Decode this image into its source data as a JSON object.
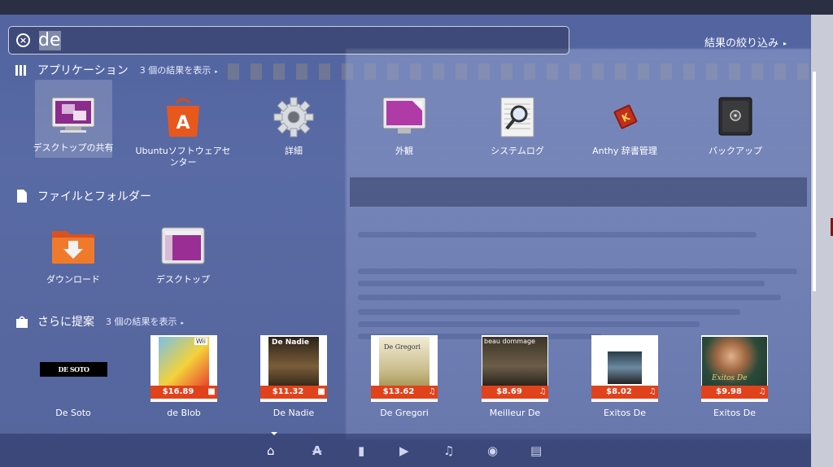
{
  "search": {
    "value": "de",
    "clear_icon": "×"
  },
  "filter": {
    "label": "結果の絞り込み",
    "arrow": "▸"
  },
  "categories": {
    "apps": {
      "title": "アプリケーション",
      "more": "3 個の結果を表示",
      "arrow": "▸"
    },
    "files": {
      "title": "ファイルとフォルダー"
    },
    "suggest": {
      "title": "さらに提案",
      "more": "3 個の結果を表示",
      "arrow": "▸"
    }
  },
  "apps": [
    {
      "label": "デスクトップの共有",
      "icon": "desktop-sharing-icon"
    },
    {
      "label": "Ubuntuソフトウェアセンター",
      "icon": "software-center-icon"
    },
    {
      "label": "詳細",
      "icon": "gear-icon"
    },
    {
      "label": "外観",
      "icon": "appearance-icon"
    },
    {
      "label": "システムログ",
      "icon": "system-log-icon"
    },
    {
      "label": "Anthy 辞書管理",
      "icon": "dictionary-icon"
    },
    {
      "label": "バックアップ",
      "icon": "backup-safe-icon"
    }
  ],
  "files": [
    {
      "label": "ダウンロード",
      "icon": "download-folder-icon"
    },
    {
      "label": "デスクトップ",
      "icon": "desktop-folder-icon"
    }
  ],
  "suggestions": [
    {
      "label": "De Soto",
      "price": "",
      "logo_text": "DE SOTO"
    },
    {
      "label": "de Blob",
      "price": "$16.89",
      "tag": "bag-icon",
      "art_text": "Wii"
    },
    {
      "label": "De Nadie",
      "price": "$11.32",
      "tag": "bag-icon",
      "art_text": "De Nadie"
    },
    {
      "label": "De Gregori",
      "price": "$13.62",
      "tag": "music-note-icon",
      "art_text": "De Gregori"
    },
    {
      "label": "Meilleur De",
      "price": "$8.69",
      "tag": "music-note-icon",
      "art_text": "beau dommage"
    },
    {
      "label": "Exitos De",
      "price": "$8.02",
      "tag": "music-note-icon",
      "art_text": ""
    },
    {
      "label": "Exitos De",
      "price": "$9.98",
      "tag": "music-note-icon",
      "art_text": "Exitos De"
    }
  ],
  "lenses": [
    {
      "name": "home-lens-icon",
      "glyph": "⌂"
    },
    {
      "name": "applications-lens-icon",
      "glyph": "A"
    },
    {
      "name": "files-lens-icon",
      "glyph": "▮"
    },
    {
      "name": "video-lens-icon",
      "glyph": "▶"
    },
    {
      "name": "music-lens-icon",
      "glyph": "♫"
    },
    {
      "name": "photo-lens-icon",
      "glyph": "◉"
    },
    {
      "name": "social-lens-icon",
      "glyph": "▤"
    }
  ],
  "colors": {
    "price_orange": "#e0421c",
    "accent_purple": "#8b2b8b"
  }
}
